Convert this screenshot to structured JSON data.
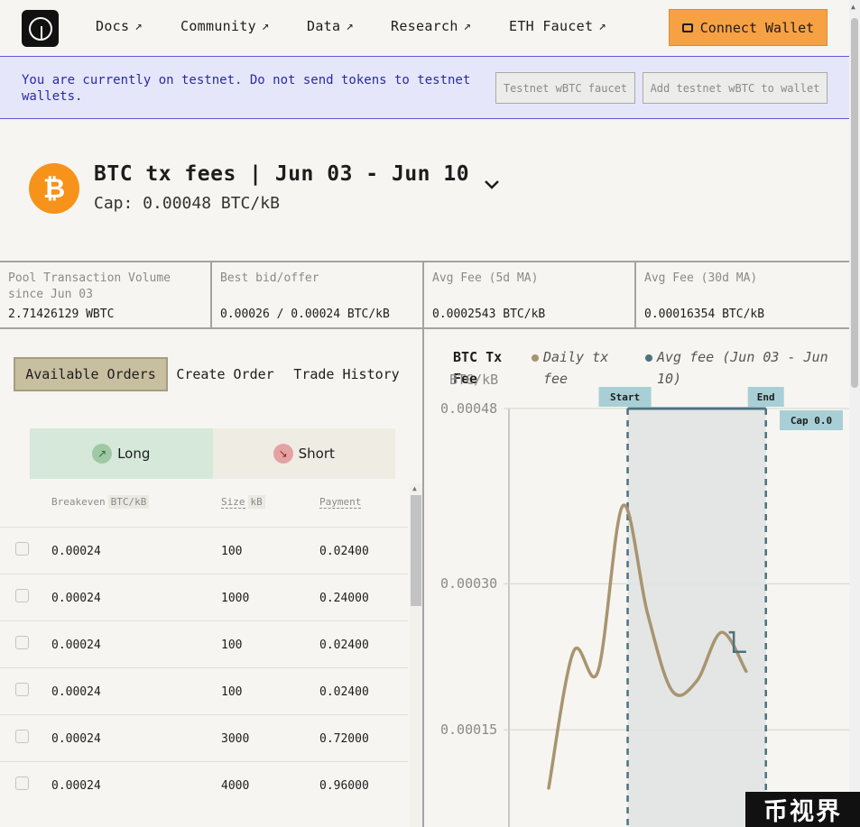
{
  "nav": {
    "links": [
      {
        "label": "Docs",
        "arrow": "↗"
      },
      {
        "label": "Community",
        "arrow": "↗"
      },
      {
        "label": "Data",
        "arrow": "↗"
      },
      {
        "label": "Research",
        "arrow": "↗"
      },
      {
        "label": "ETH Faucet",
        "arrow": "↗"
      }
    ],
    "connect_label": "Connect Wallet"
  },
  "banner": {
    "text": "You are currently on testnet. Do not send tokens to testnet wallets.",
    "faucet_button": "Testnet wBTC faucet",
    "add_button": "Add testnet wBTC to wallet"
  },
  "header": {
    "icon_glyph": "₿",
    "title": "BTC tx fees | Jun 03 - Jun 10",
    "cap": "Cap: 0.00048 BTC/kB"
  },
  "stats": [
    {
      "label": "Pool Transaction Volume since Jun 03",
      "value": "2.71426129 WBTC"
    },
    {
      "label": "Best bid/offer",
      "value": "0.00026 / 0.00024 BTC/kB"
    },
    {
      "label": "Avg Fee (5d MA)",
      "value": "0.0002543 BTC/kB"
    },
    {
      "label": "Avg Fee (30d MA)",
      "value": "0.00016354 BTC/kB"
    }
  ],
  "orders": {
    "tabs": [
      "Available Orders",
      "Create Order",
      "Trade History"
    ],
    "long_label": "Long",
    "short_label": "Short",
    "long_icon": "↗",
    "short_icon": "↘",
    "columns": {
      "breakeven": "Breakeven",
      "breakeven_unit": "BTC/kB",
      "size": "Size",
      "size_unit": "kB",
      "payment": "Payment"
    },
    "rows": [
      {
        "breakeven": "0.00024",
        "size": "100",
        "payment": "0.02400"
      },
      {
        "breakeven": "0.00024",
        "size": "1000",
        "payment": "0.24000"
      },
      {
        "breakeven": "0.00024",
        "size": "100",
        "payment": "0.02400"
      },
      {
        "breakeven": "0.00024",
        "size": "100",
        "payment": "0.02400"
      },
      {
        "breakeven": "0.00024",
        "size": "3000",
        "payment": "0.72000"
      },
      {
        "breakeven": "0.00024",
        "size": "4000",
        "payment": "0.96000"
      }
    ]
  },
  "chart_data": {
    "type": "line",
    "title": "BTC Tx Fee",
    "ylabel": "BTC/kB",
    "ylim": [
      5e-05,
      0.00048
    ],
    "yticks": [
      {
        "value": 0.00048,
        "label": "0.00048"
      },
      {
        "value": 0.0003,
        "label": "0.00030"
      },
      {
        "value": 0.00015,
        "label": "0.00015"
      }
    ],
    "grid": true,
    "legend": [
      {
        "name": "Daily tx fee",
        "color": "#a99470"
      },
      {
        "name": "Avg fee (Jun 03 - Jun 10)",
        "color": "#4b7280"
      }
    ],
    "xlim": [
      0,
      14
    ],
    "series": [
      {
        "name": "Daily tx fee",
        "color": "#a99470",
        "x": [
          0,
          1,
          2,
          3,
          4,
          5,
          6,
          7,
          8
        ],
        "values": [
          9e-05,
          0.00023,
          0.00021,
          0.00038,
          0.00027,
          0.00019,
          0.0002,
          0.00025,
          0.00021
        ]
      },
      {
        "name": "Avg fee (Jun 03 - Jun 10)",
        "color": "#4b7280",
        "x": [
          3.2,
          3.2,
          8.8,
          8.8
        ],
        "values": [
          0.00048,
          0.00048,
          0.00048,
          0.00048
        ]
      }
    ],
    "annotations": [
      {
        "label": "Start",
        "x": 3.2
      },
      {
        "label": "End",
        "x": 8.8
      },
      {
        "label": "Cap 0.0",
        "y": 0.00048
      }
    ],
    "avg_step": {
      "x": [
        7.3,
        7.5,
        7.5,
        8.0
      ],
      "values": [
        0.00025,
        0.00025,
        0.00023,
        0.00023
      ]
    }
  },
  "watermark": "币视界"
}
